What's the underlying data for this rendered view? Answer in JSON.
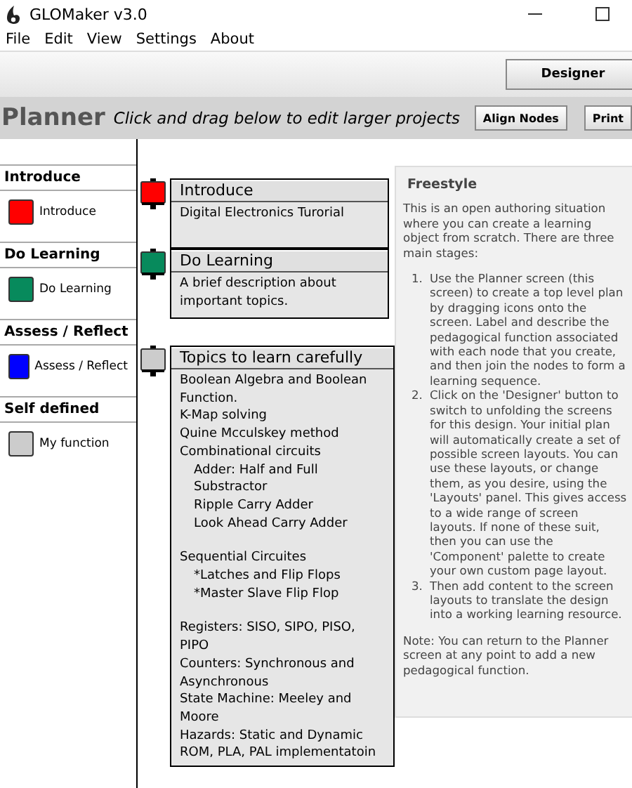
{
  "window": {
    "title": "GLOMaker v3.0"
  },
  "menu": [
    "File",
    "Edit",
    "View",
    "Settings",
    "About"
  ],
  "toolbar": {
    "buttons": [
      "Designer"
    ]
  },
  "planner_bar": {
    "title": "Planner",
    "hint": "Click and drag below to edit larger projects",
    "buttons": [
      "Align Nodes",
      "Print"
    ]
  },
  "palette": [
    {
      "heading": "Introduce",
      "item": "Introduce",
      "color": "#ff0000"
    },
    {
      "heading": "Do Learning",
      "item": "Do Learning",
      "color": "#078a5c"
    },
    {
      "heading": "Assess / Reflect",
      "item": "Assess / Reflect",
      "color": "#0000ff"
    },
    {
      "heading": "Self defined",
      "item": "My function",
      "color": "#cccccc"
    }
  ],
  "nodes": [
    {
      "title": "Introduce",
      "color": "#ff0000",
      "groups": [
        {
          "lines": [
            {
              "text": "Digital Electronics Turorial"
            }
          ]
        }
      ]
    },
    {
      "title": "Do Learning",
      "color": "#078a5c",
      "groups": [
        {
          "lines": [
            {
              "text": "A brief description about important topics."
            }
          ]
        }
      ]
    },
    {
      "title": "Topics to learn carefully",
      "color": "#cccccc",
      "groups": [
        {
          "lines": [
            {
              "text": "Boolean Algebra and Boolean Function."
            },
            {
              "text": "K-Map solving"
            },
            {
              "text": "Quine Mcculskey method"
            },
            {
              "text": "Combinational circuits",
              "children": [
                {
                  "text": "Adder: Half and Full"
                },
                {
                  "text": "Substractor"
                },
                {
                  "text": "Ripple Carry Adder"
                },
                {
                  "text": "Look Ahead Carry Adder"
                }
              ]
            }
          ]
        },
        {
          "lines": [
            {
              "text": "Sequential Circuites",
              "children": [
                {
                  "text": "*Latches and Flip Flops"
                },
                {
                  "text": "*Master Slave Flip Flop"
                }
              ]
            }
          ]
        },
        {
          "lines": [
            {
              "text": "Registers: SISO, SIPO, PISO, PIPO"
            },
            {
              "text": "Counters: Synchronous and Asynchronous"
            },
            {
              "text": "State Machine: Meeley and Moore"
            },
            {
              "text": "Hazards: Static and Dynamic"
            },
            {
              "text": "ROM, PLA, PAL implementatoin"
            }
          ]
        }
      ]
    }
  ],
  "help": {
    "title": "Freestyle",
    "intro": "This is an open authoring situation where you can create a learning object from scratch. There are three main stages:",
    "steps": [
      {
        "marker": "1.",
        "text": "Use the Planner screen (this screen) to create a top level plan by dragging icons onto the screen. Label and describe the pedagogical function associated with each node that you create, and then join the nodes to form a learning sequence."
      },
      {
        "marker": "2.",
        "text": "Click on the 'Designer' button to switch to unfolding the screens for this design. Your initial plan will automatically create a set of possible screen layouts. You can use these layouts, or change them, as you desire, using the 'Layouts' panel. This gives access to a wide range of screen layouts. If none of these suit, then you can use the 'Component' palette to create your own custom page layout."
      },
      {
        "marker": "3.",
        "text": "Then add content to the screen layouts to translate the design into a working learning resource."
      }
    ],
    "note": "Note: You can return to the Planner screen at any point to add a new pedagogical function."
  }
}
